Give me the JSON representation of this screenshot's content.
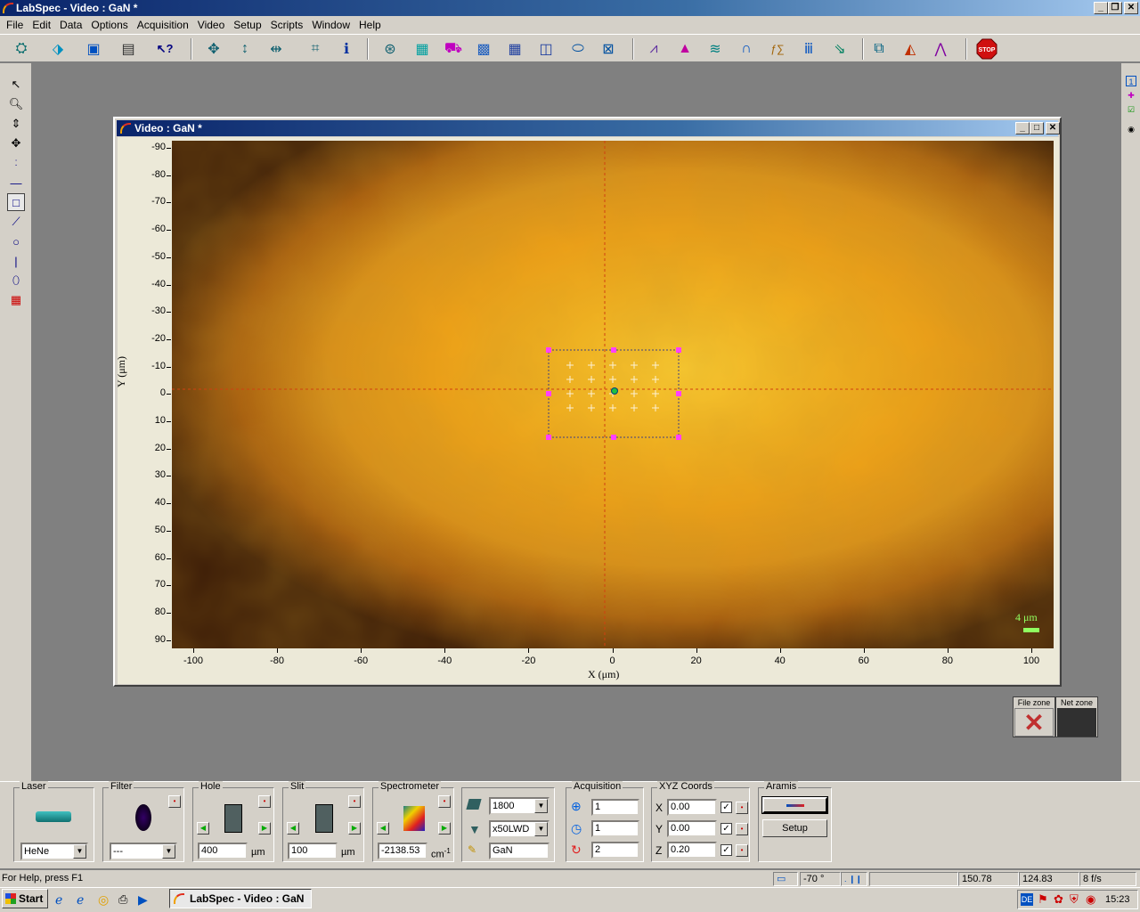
{
  "app": {
    "title": "LabSpec - Video : GaN *",
    "window_buttons": [
      "_",
      "❐",
      "✕"
    ]
  },
  "menu": [
    "File",
    "Edit",
    "Data",
    "Options",
    "Acquisition",
    "Video",
    "Setup",
    "Scripts",
    "Window",
    "Help"
  ],
  "toolbar": {
    "icons": [
      "open-icon",
      "load-icon",
      "save-icon",
      "print-icon",
      "help-icon",
      "video-move-icon",
      "vertical-fit-icon",
      "horizontal-fit-icon",
      "map-icon",
      "info-icon",
      "spectrum-acquire-icon",
      "grid-icon",
      "autofocus-icon",
      "map-grid-icon",
      "table-grid-icon",
      "display-icon",
      "camera-icon",
      "scale-icon",
      "peaks-icon",
      "multi-peaks-icon",
      "baseline-icon",
      "fit-icon",
      "formula-icon",
      "spectra-icon",
      "export-icon",
      "layers-icon",
      "filter-icon",
      "graph-icon",
      "stop-icon"
    ],
    "stop_label": "STOP"
  },
  "video_window": {
    "title": "Video : GaN *",
    "x_axis_label": "X (μm)",
    "y_axis_label": "Y (μm)",
    "x_ticks": [
      "-100",
      "-80",
      "-60",
      "-40",
      "-20",
      "0",
      "20",
      "40",
      "60",
      "80",
      "100"
    ],
    "y_ticks": [
      "-90",
      "-80",
      "-70",
      "-60",
      "-50",
      "-40",
      "-30",
      "-20",
      "-10",
      "0",
      "10",
      "20",
      "30",
      "40",
      "50",
      "60",
      "70",
      "80",
      "90"
    ],
    "scale_bar_label": "4 μm",
    "colors": {
      "crosshair": "#d04010",
      "map_rect": "#404080",
      "handles": "#ff40ff",
      "grid_points": "#ffffff",
      "scale": "#90ff60"
    }
  },
  "zones": {
    "file_zone": "File zone",
    "net_zone": "Net zone"
  },
  "panel": {
    "laser": {
      "title": "Laser",
      "value": "HeNe"
    },
    "filter": {
      "title": "Filter",
      "value": "---"
    },
    "hole": {
      "title": "Hole",
      "value": "400",
      "unit": "µm"
    },
    "slit": {
      "title": "Slit",
      "value": "100",
      "unit": "µm"
    },
    "spectrometer": {
      "title": "Spectrometer",
      "value": "-2138.53",
      "unit": "cm",
      "unit_sup": "-1"
    },
    "grating": {
      "value": "1800"
    },
    "objective": {
      "value": "x50LWD"
    },
    "sample": {
      "value": "GaN"
    },
    "acquisition": {
      "title": "Acquisition",
      "time": "1",
      "accum": "1",
      "cycles": "2"
    },
    "xyz": {
      "title": "XYZ Coords",
      "x_label": "X",
      "x": "0.00",
      "y_label": "Y",
      "y": "0.00",
      "z_label": "Z",
      "z": "0.20"
    },
    "aramis": {
      "title": "Aramis",
      "setup_label": "Setup"
    }
  },
  "status": {
    "help": "For Help, press F1",
    "angle": "-70 °",
    "coord1": "150.78",
    "coord2": "124.83",
    "fps": "8 f/s"
  },
  "taskbar": {
    "start": "Start",
    "task": "LabSpec - Video : GaN *",
    "lang": "DE",
    "time": "15:23"
  }
}
